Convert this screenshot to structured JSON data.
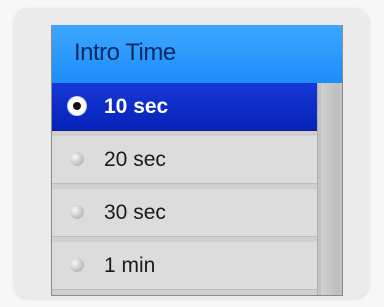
{
  "menu": {
    "title": "Intro Time",
    "options": [
      {
        "label": "10 sec",
        "selected": true
      },
      {
        "label": "20 sec",
        "selected": false
      },
      {
        "label": "30 sec",
        "selected": false
      },
      {
        "label": "1 min",
        "selected": false
      }
    ]
  },
  "colors": {
    "header": "#1c8ef9",
    "selected": "#0a2fc8",
    "item": "#dcdcdc"
  }
}
